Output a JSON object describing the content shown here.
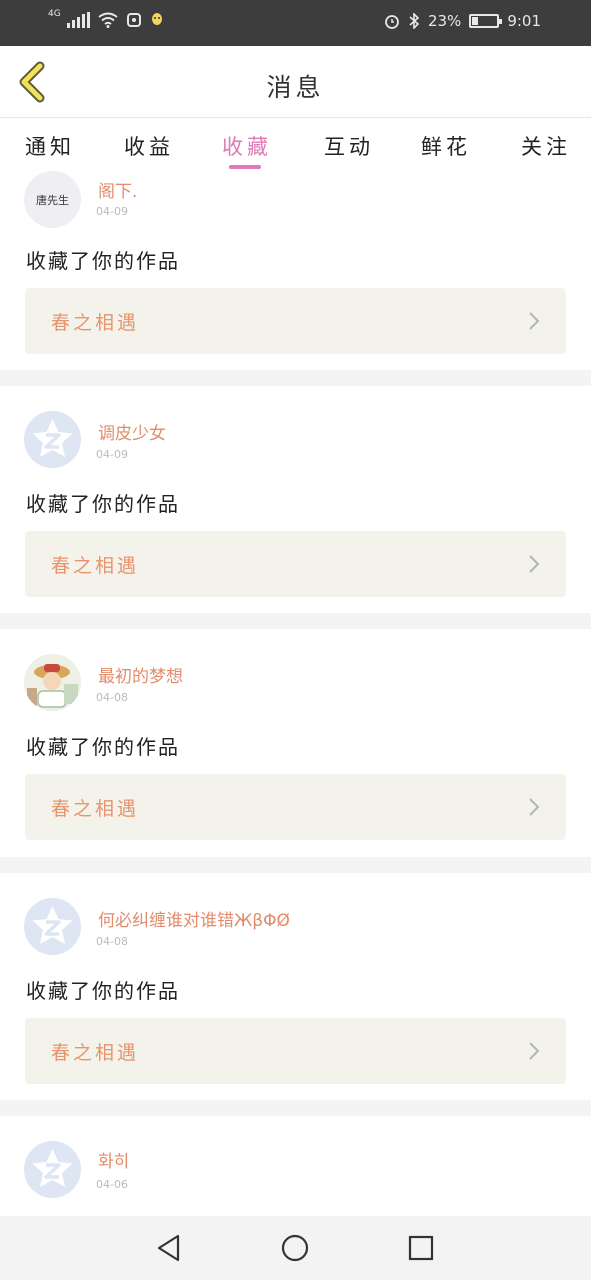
{
  "status_bar": {
    "network": "4G",
    "battery": "23%",
    "battery_level": 0.23,
    "time": "9:01"
  },
  "header": {
    "title": "消息",
    "back_icon": "chevron-left-icon"
  },
  "tabs": [
    {
      "label": "通知",
      "active": false
    },
    {
      "label": "收益",
      "active": false
    },
    {
      "label": "收藏",
      "active": true
    },
    {
      "label": "互动",
      "active": false
    },
    {
      "label": "鲜花",
      "active": false
    },
    {
      "label": "关注",
      "active": false
    }
  ],
  "feed": [
    {
      "avatar_text": "唐先生",
      "avatar_type": "text",
      "username": "阁下.",
      "date": "04-09",
      "action": "收藏了你的作品",
      "work_title": "春之相遇"
    },
    {
      "avatar_type": "placeholder",
      "username": "调皮少女",
      "date": "04-09",
      "action": "收藏了你的作品",
      "work_title": "春之相遇"
    },
    {
      "avatar_type": "photo",
      "username": "最初的梦想",
      "date": "04-08",
      "action": "收藏了你的作品",
      "work_title": "春之相遇"
    },
    {
      "avatar_type": "placeholder",
      "username": "何必纠缠谁对谁错ЖβΦØ",
      "date": "04-08",
      "action": "收藏了你的作品",
      "work_title": "春之相遇"
    },
    {
      "avatar_type": "placeholder",
      "username": "화히",
      "date": "04-06"
    }
  ],
  "colors": {
    "accent": "#e07ab5",
    "username": "#e38c6c",
    "card_bg": "#f3f3ec",
    "status_bar_bg": "#3d3d3d"
  },
  "nav_bar": {
    "icons": [
      "back-triangle-icon",
      "home-circle-icon",
      "recents-square-icon"
    ]
  }
}
